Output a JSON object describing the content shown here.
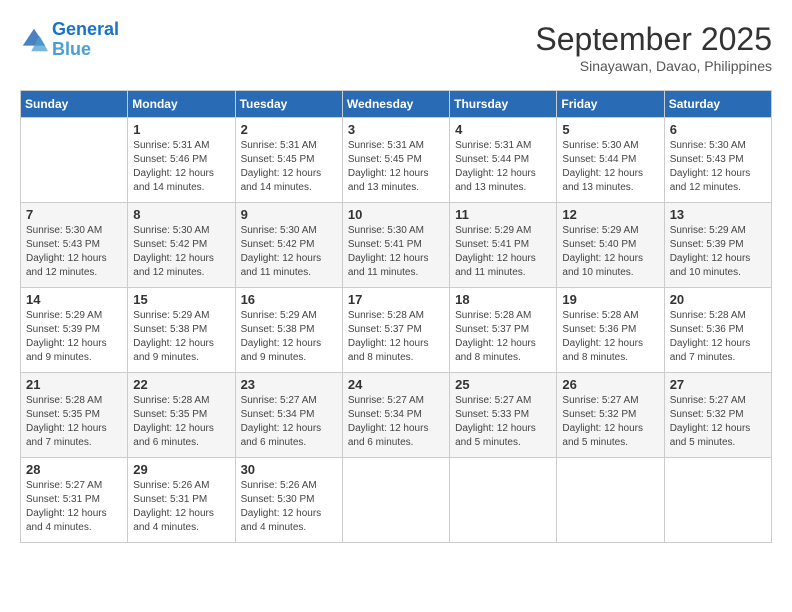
{
  "logo": {
    "line1": "General",
    "line2": "Blue"
  },
  "header": {
    "title": "September 2025",
    "subtitle": "Sinayawan, Davao, Philippines"
  },
  "weekdays": [
    "Sunday",
    "Monday",
    "Tuesday",
    "Wednesday",
    "Thursday",
    "Friday",
    "Saturday"
  ],
  "weeks": [
    [
      {
        "day": "",
        "sunrise": "",
        "sunset": "",
        "daylight": ""
      },
      {
        "day": "1",
        "sunrise": "Sunrise: 5:31 AM",
        "sunset": "Sunset: 5:46 PM",
        "daylight": "Daylight: 12 hours and 14 minutes."
      },
      {
        "day": "2",
        "sunrise": "Sunrise: 5:31 AM",
        "sunset": "Sunset: 5:45 PM",
        "daylight": "Daylight: 12 hours and 14 minutes."
      },
      {
        "day": "3",
        "sunrise": "Sunrise: 5:31 AM",
        "sunset": "Sunset: 5:45 PM",
        "daylight": "Daylight: 12 hours and 13 minutes."
      },
      {
        "day": "4",
        "sunrise": "Sunrise: 5:31 AM",
        "sunset": "Sunset: 5:44 PM",
        "daylight": "Daylight: 12 hours and 13 minutes."
      },
      {
        "day": "5",
        "sunrise": "Sunrise: 5:30 AM",
        "sunset": "Sunset: 5:44 PM",
        "daylight": "Daylight: 12 hours and 13 minutes."
      },
      {
        "day": "6",
        "sunrise": "Sunrise: 5:30 AM",
        "sunset": "Sunset: 5:43 PM",
        "daylight": "Daylight: 12 hours and 12 minutes."
      }
    ],
    [
      {
        "day": "7",
        "sunrise": "Sunrise: 5:30 AM",
        "sunset": "Sunset: 5:43 PM",
        "daylight": "Daylight: 12 hours and 12 minutes."
      },
      {
        "day": "8",
        "sunrise": "Sunrise: 5:30 AM",
        "sunset": "Sunset: 5:42 PM",
        "daylight": "Daylight: 12 hours and 12 minutes."
      },
      {
        "day": "9",
        "sunrise": "Sunrise: 5:30 AM",
        "sunset": "Sunset: 5:42 PM",
        "daylight": "Daylight: 12 hours and 11 minutes."
      },
      {
        "day": "10",
        "sunrise": "Sunrise: 5:30 AM",
        "sunset": "Sunset: 5:41 PM",
        "daylight": "Daylight: 12 hours and 11 minutes."
      },
      {
        "day": "11",
        "sunrise": "Sunrise: 5:29 AM",
        "sunset": "Sunset: 5:41 PM",
        "daylight": "Daylight: 12 hours and 11 minutes."
      },
      {
        "day": "12",
        "sunrise": "Sunrise: 5:29 AM",
        "sunset": "Sunset: 5:40 PM",
        "daylight": "Daylight: 12 hours and 10 minutes."
      },
      {
        "day": "13",
        "sunrise": "Sunrise: 5:29 AM",
        "sunset": "Sunset: 5:39 PM",
        "daylight": "Daylight: 12 hours and 10 minutes."
      }
    ],
    [
      {
        "day": "14",
        "sunrise": "Sunrise: 5:29 AM",
        "sunset": "Sunset: 5:39 PM",
        "daylight": "Daylight: 12 hours and 9 minutes."
      },
      {
        "day": "15",
        "sunrise": "Sunrise: 5:29 AM",
        "sunset": "Sunset: 5:38 PM",
        "daylight": "Daylight: 12 hours and 9 minutes."
      },
      {
        "day": "16",
        "sunrise": "Sunrise: 5:29 AM",
        "sunset": "Sunset: 5:38 PM",
        "daylight": "Daylight: 12 hours and 9 minutes."
      },
      {
        "day": "17",
        "sunrise": "Sunrise: 5:28 AM",
        "sunset": "Sunset: 5:37 PM",
        "daylight": "Daylight: 12 hours and 8 minutes."
      },
      {
        "day": "18",
        "sunrise": "Sunrise: 5:28 AM",
        "sunset": "Sunset: 5:37 PM",
        "daylight": "Daylight: 12 hours and 8 minutes."
      },
      {
        "day": "19",
        "sunrise": "Sunrise: 5:28 AM",
        "sunset": "Sunset: 5:36 PM",
        "daylight": "Daylight: 12 hours and 8 minutes."
      },
      {
        "day": "20",
        "sunrise": "Sunrise: 5:28 AM",
        "sunset": "Sunset: 5:36 PM",
        "daylight": "Daylight: 12 hours and 7 minutes."
      }
    ],
    [
      {
        "day": "21",
        "sunrise": "Sunrise: 5:28 AM",
        "sunset": "Sunset: 5:35 PM",
        "daylight": "Daylight: 12 hours and 7 minutes."
      },
      {
        "day": "22",
        "sunrise": "Sunrise: 5:28 AM",
        "sunset": "Sunset: 5:35 PM",
        "daylight": "Daylight: 12 hours and 6 minutes."
      },
      {
        "day": "23",
        "sunrise": "Sunrise: 5:27 AM",
        "sunset": "Sunset: 5:34 PM",
        "daylight": "Daylight: 12 hours and 6 minutes."
      },
      {
        "day": "24",
        "sunrise": "Sunrise: 5:27 AM",
        "sunset": "Sunset: 5:34 PM",
        "daylight": "Daylight: 12 hours and 6 minutes."
      },
      {
        "day": "25",
        "sunrise": "Sunrise: 5:27 AM",
        "sunset": "Sunset: 5:33 PM",
        "daylight": "Daylight: 12 hours and 5 minutes."
      },
      {
        "day": "26",
        "sunrise": "Sunrise: 5:27 AM",
        "sunset": "Sunset: 5:32 PM",
        "daylight": "Daylight: 12 hours and 5 minutes."
      },
      {
        "day": "27",
        "sunrise": "Sunrise: 5:27 AM",
        "sunset": "Sunset: 5:32 PM",
        "daylight": "Daylight: 12 hours and 5 minutes."
      }
    ],
    [
      {
        "day": "28",
        "sunrise": "Sunrise: 5:27 AM",
        "sunset": "Sunset: 5:31 PM",
        "daylight": "Daylight: 12 hours and 4 minutes."
      },
      {
        "day": "29",
        "sunrise": "Sunrise: 5:26 AM",
        "sunset": "Sunset: 5:31 PM",
        "daylight": "Daylight: 12 hours and 4 minutes."
      },
      {
        "day": "30",
        "sunrise": "Sunrise: 5:26 AM",
        "sunset": "Sunset: 5:30 PM",
        "daylight": "Daylight: 12 hours and 4 minutes."
      },
      {
        "day": "",
        "sunrise": "",
        "sunset": "",
        "daylight": ""
      },
      {
        "day": "",
        "sunrise": "",
        "sunset": "",
        "daylight": ""
      },
      {
        "day": "",
        "sunrise": "",
        "sunset": "",
        "daylight": ""
      },
      {
        "day": "",
        "sunrise": "",
        "sunset": "",
        "daylight": ""
      }
    ]
  ]
}
